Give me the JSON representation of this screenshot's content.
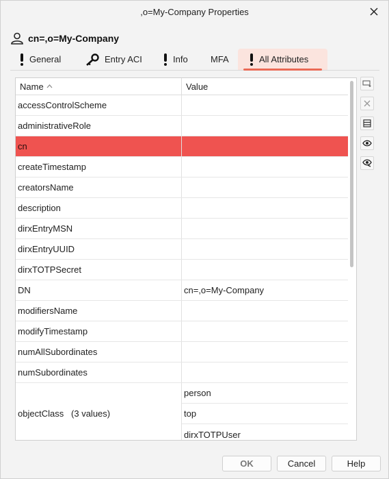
{
  "window": {
    "title": ",o=My-Company Properties"
  },
  "entry": {
    "name": "cn=,o=My-Company"
  },
  "tabs": [
    {
      "label": "General",
      "icon": "exclamation-icon"
    },
    {
      "label": "Entry ACI",
      "icon": "key-icon"
    },
    {
      "label": "Info",
      "icon": "exclamation-icon"
    },
    {
      "label": "MFA",
      "icon": ""
    },
    {
      "label": "All Attributes",
      "icon": "exclamation-icon",
      "active": true
    }
  ],
  "grid": {
    "headers": {
      "name": "Name",
      "value": "Value"
    },
    "sort": "ascending",
    "rows": [
      {
        "name": "accessControlScheme",
        "value": ""
      },
      {
        "name": "administrativeRole",
        "value": ""
      },
      {
        "name": "cn",
        "value": "",
        "selected": true
      },
      {
        "name": "createTimestamp",
        "value": ""
      },
      {
        "name": "creatorsName",
        "value": ""
      },
      {
        "name": "description",
        "value": ""
      },
      {
        "name": "dirxEntryMSN",
        "value": ""
      },
      {
        "name": "dirxEntryUUID",
        "value": ""
      },
      {
        "name": "dirxTOTPSecret",
        "value": ""
      },
      {
        "name": "DN",
        "value": "cn=,o=My-Company"
      },
      {
        "name": "modifiersName",
        "value": ""
      },
      {
        "name": "modifyTimestamp",
        "value": ""
      },
      {
        "name": "numAllSubordinates",
        "value": ""
      },
      {
        "name": "numSubordinates",
        "value": ""
      }
    ],
    "multi_row": {
      "name": "objectClass   (3 values)",
      "values": [
        "person",
        "top",
        "dirxTOTPUser"
      ]
    }
  },
  "side_tools": [
    "add-value-icon",
    "delete-icon",
    "edit-list-icon",
    "show-icon",
    "hide-icon"
  ],
  "buttons": {
    "ok": "OK",
    "cancel": "Cancel",
    "help": "Help"
  },
  "colors": {
    "selected_row": "#ef5350",
    "tab_active_bg": "#fbe4de",
    "tab_accent": "#ea6a55"
  }
}
